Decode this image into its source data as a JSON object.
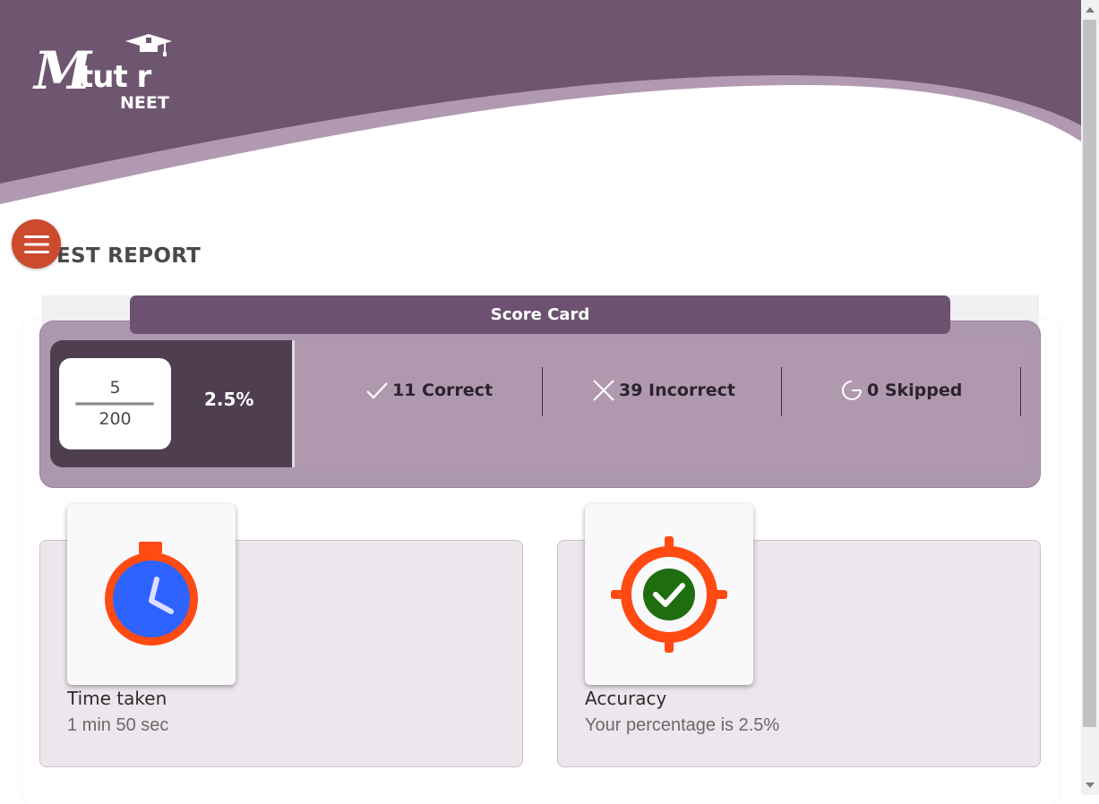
{
  "brand": {
    "logo_m": "M",
    "logo_tutor": "tut r",
    "logo_sub": "NEET"
  },
  "page": {
    "title": "TEST REPORT",
    "menu_icon": "hamburger-menu-icon"
  },
  "score_card": {
    "label": "Score Card",
    "score": "5",
    "total": "200",
    "percentage": "2.5%",
    "stats": [
      {
        "icon": "check-icon",
        "label": "11 Correct"
      },
      {
        "icon": "cross-icon",
        "label": "39 Incorrect"
      },
      {
        "icon": "skip-icon",
        "label": "0 Skipped"
      }
    ]
  },
  "cards": [
    {
      "icon": "stopwatch-icon",
      "title": "Time taken",
      "value": "1 min 50 sec"
    },
    {
      "icon": "target-check-icon",
      "title": "Accuracy",
      "value": "Your percentage is 2.5%"
    }
  ],
  "colors": {
    "header": "#6e5570",
    "score_outer": "#ad97ae",
    "score_dark": "#4f3d50",
    "tab": "#6c5270",
    "menu_button": "#cc4a2e",
    "card_bg": "#ede6ec"
  }
}
